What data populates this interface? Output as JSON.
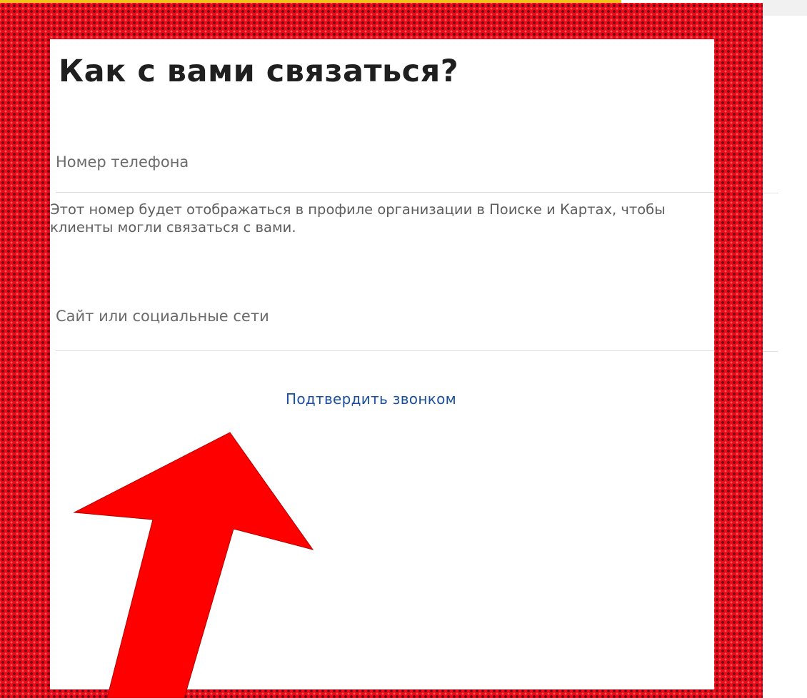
{
  "form": {
    "title": "Как с вами связаться?",
    "phone_label": "Номер телефона",
    "phone_helper": "Этот номер будет отображаться в профиле организации в Поиске и Картах, чтобы клиенты могли связаться с вами.",
    "site_label": "Сайт или социальные сети",
    "confirm_link": "Подтвердить звонком"
  },
  "overlay": {
    "frame_color": "#e8091a",
    "arrow_color": "#ff0000",
    "arrow_icon": "red-arrow-icon"
  }
}
